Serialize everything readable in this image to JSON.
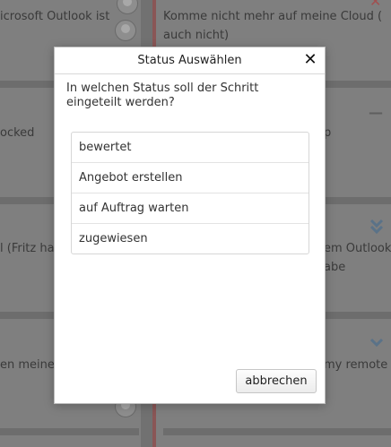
{
  "background": {
    "cards": [
      {
        "text": "icrosoft Outlook ist"
      },
      {
        "text": "Komme nicht mehr auf meine Cloud ("
      },
      {
        "text": "auch nicht)"
      },
      {
        "text": "ocked"
      },
      {
        "text": "p"
      },
      {
        "text": "l (Fritz ha"
      },
      {
        "text": "em Outlook"
      },
      {
        "text": "abe"
      },
      {
        "text": "en meine"
      },
      {
        "text": "my remote"
      }
    ],
    "colors": {
      "red_accent": "#a05050",
      "blue_accent": "#5a7288"
    }
  },
  "dialog": {
    "title": "Status Auswählen",
    "close_icon": "close-icon",
    "prompt": "In welchen Status soll der Schritt eingeteilt werden?",
    "options": [
      {
        "label": "bewertet"
      },
      {
        "label": "Angebot erstellen"
      },
      {
        "label": "auf Auftrag warten"
      },
      {
        "label": "zugewiesen"
      }
    ],
    "cancel_label": "abbrechen"
  }
}
